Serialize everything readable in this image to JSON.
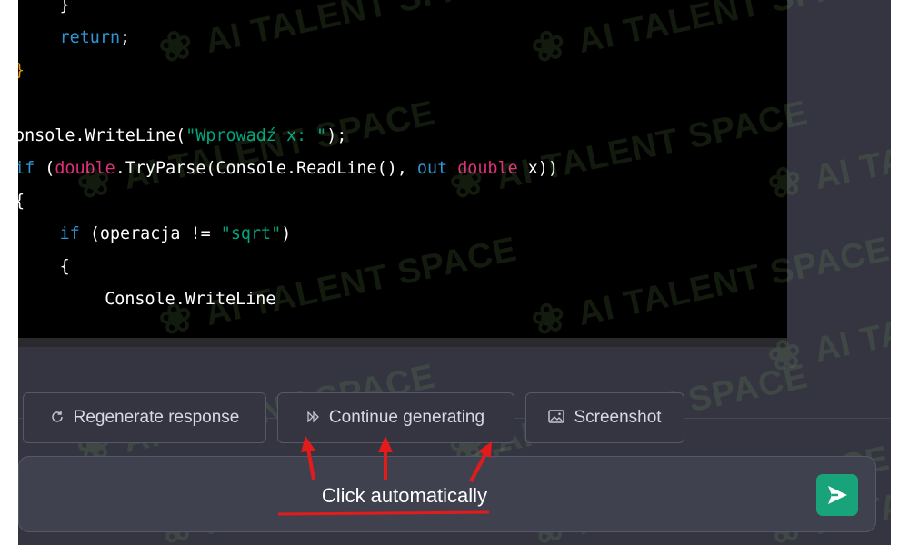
{
  "code": {
    "lines": [
      {
        "indent": "    ",
        "tokens": [
          {
            "t": "}",
            "c": "punct"
          }
        ]
      },
      {
        "indent": "    ",
        "tokens": [
          {
            "t": "return",
            "c": "kw"
          },
          {
            "t": ";",
            "c": "punct"
          }
        ]
      },
      {
        "indent": "",
        "tokens": [
          {
            "t": "}",
            "c": "brace-red"
          }
        ]
      },
      {
        "indent": "",
        "tokens": []
      },
      {
        "indent": "",
        "tokens": [
          {
            "t": "onsole.WriteLine(",
            "c": "punct"
          },
          {
            "t": "\"Wprowadź x: \"",
            "c": "str"
          },
          {
            "t": ");",
            "c": "punct"
          }
        ]
      },
      {
        "indent": "",
        "tokens": [
          {
            "t": "if",
            "c": "kw"
          },
          {
            "t": " (",
            "c": "punct"
          },
          {
            "t": "double",
            "c": "type"
          },
          {
            "t": ".TryParse(Console.ReadLine(), ",
            "c": "punct"
          },
          {
            "t": "out",
            "c": "kw"
          },
          {
            "t": " ",
            "c": "punct"
          },
          {
            "t": "double",
            "c": "type"
          },
          {
            "t": " x))",
            "c": "punct"
          }
        ]
      },
      {
        "indent": "",
        "tokens": [
          {
            "t": "{",
            "c": "punct"
          }
        ]
      },
      {
        "indent": "    ",
        "tokens": [
          {
            "t": "if",
            "c": "kw"
          },
          {
            "t": " (operacja != ",
            "c": "punct"
          },
          {
            "t": "\"sqrt\"",
            "c": "str"
          },
          {
            "t": ")",
            "c": "punct"
          }
        ]
      },
      {
        "indent": "    ",
        "tokens": [
          {
            "t": "{",
            "c": "punct"
          }
        ]
      },
      {
        "indent": "        ",
        "tokens": [
          {
            "t": "Console.WriteLine",
            "c": "punct"
          }
        ]
      }
    ]
  },
  "actions": {
    "regenerate_label": "Regenerate response",
    "continue_label": "Continue generating",
    "screenshot_label": "Screenshot"
  },
  "annotation": {
    "text": "Click automatically"
  },
  "watermark": {
    "text": "AI TALENT SPACE"
  },
  "colors": {
    "background": "#343541",
    "code_bg": "#000000",
    "send_button": "#19a37a",
    "annotation_red": "#e31b1b"
  },
  "icons": {
    "regenerate": "refresh-icon",
    "continue": "fast-forward-icon",
    "screenshot": "image-icon",
    "send": "send-icon"
  }
}
